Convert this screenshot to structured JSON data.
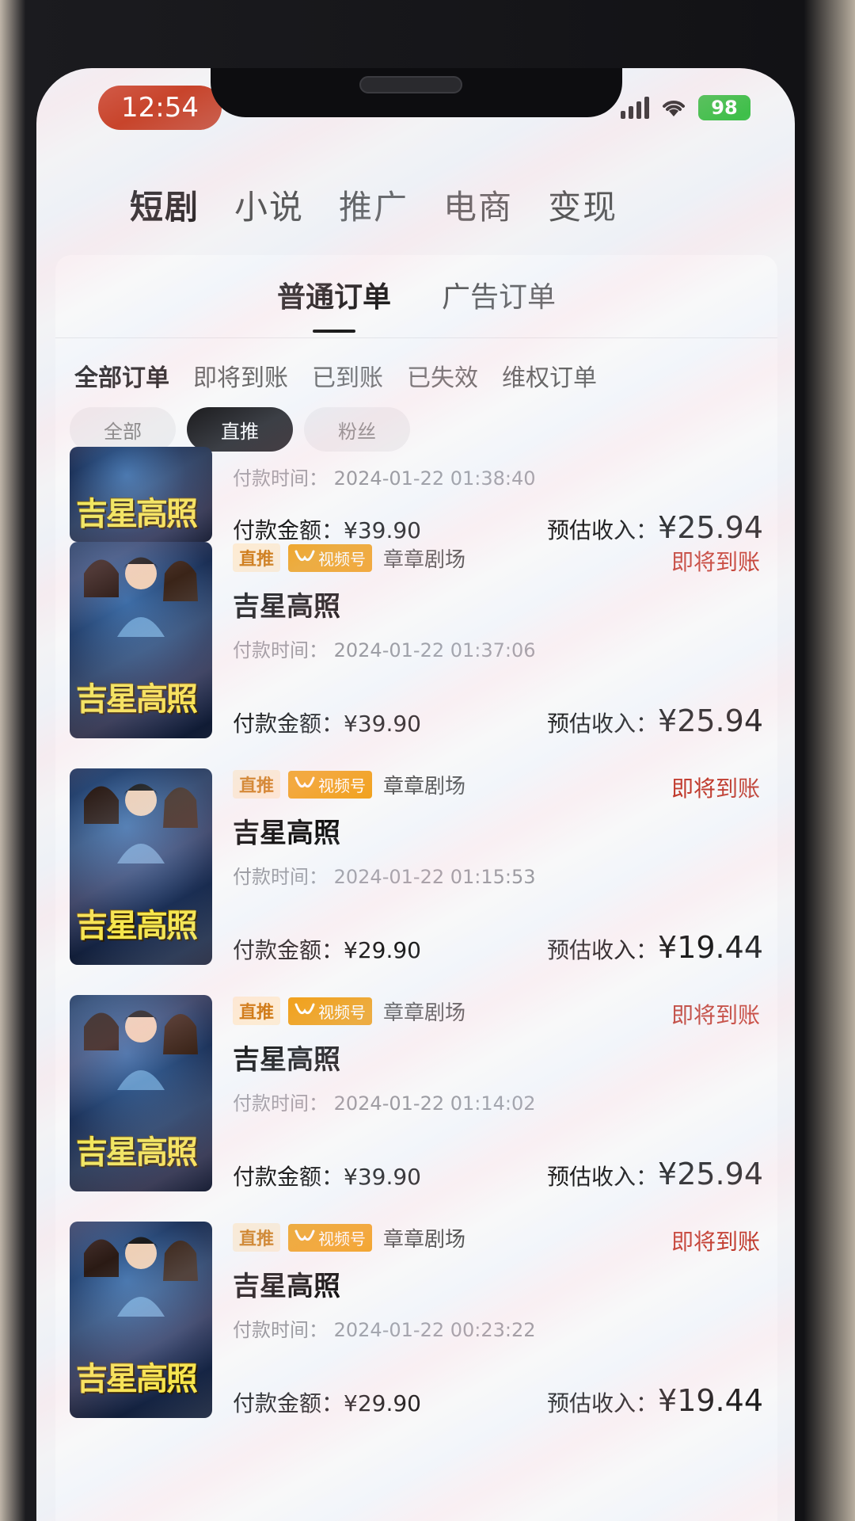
{
  "status_bar": {
    "time": "12:54",
    "battery": "98"
  },
  "top_tabs": [
    {
      "label": "短剧",
      "active": true
    },
    {
      "label": "小说",
      "active": false
    },
    {
      "label": "推广",
      "active": false
    },
    {
      "label": "电商",
      "active": false
    },
    {
      "label": "变现",
      "active": false
    }
  ],
  "sub_tabs": [
    {
      "label": "普通订单",
      "active": true
    },
    {
      "label": "广告订单",
      "active": false
    }
  ],
  "status_filters": [
    {
      "label": "全部订单",
      "active": true
    },
    {
      "label": "即将到账",
      "active": false
    },
    {
      "label": "已到账",
      "active": false
    },
    {
      "label": "已失效",
      "active": false
    },
    {
      "label": "维权订单",
      "active": false
    }
  ],
  "chips": [
    {
      "label": "全部",
      "active": false
    },
    {
      "label": "直推",
      "active": true
    },
    {
      "label": "粉丝",
      "active": false
    }
  ],
  "poster_title": "吉星高照",
  "orders": [
    {
      "partial": true,
      "pay_time": "付款时间：  2024-01-22 01:38:40",
      "pay_amount": "付款金额：¥39.90",
      "estimate_label": "预估收入：",
      "estimate_value": "¥25.94"
    },
    {
      "tag": "直推",
      "platform": "视频号",
      "source": "章章剧场",
      "status": "即将到账",
      "title": "吉星高照",
      "pay_time": "付款时间：  2024-01-22 01:37:06",
      "pay_amount": "付款金额：¥39.90",
      "estimate_label": "预估收入：",
      "estimate_value": "¥25.94"
    },
    {
      "tag": "直推",
      "platform": "视频号",
      "source": "章章剧场",
      "status": "即将到账",
      "title": "吉星高照",
      "pay_time": "付款时间：  2024-01-22 01:15:53",
      "pay_amount": "付款金额：¥29.90",
      "estimate_label": "预估收入：",
      "estimate_value": "¥19.44"
    },
    {
      "tag": "直推",
      "platform": "视频号",
      "source": "章章剧场",
      "status": "即将到账",
      "title": "吉星高照",
      "pay_time": "付款时间：  2024-01-22 01:14:02",
      "pay_amount": "付款金额：¥39.90",
      "estimate_label": "预估收入：",
      "estimate_value": "¥25.94"
    },
    {
      "tag": "直推",
      "platform": "视频号",
      "source": "章章剧场",
      "status": "即将到账",
      "title": "吉星高照",
      "pay_time": "付款时间：  2024-01-22 00:23:22",
      "pay_amount": "付款金额：¥29.90",
      "estimate_label": "预估收入：",
      "estimate_value": "¥19.44"
    }
  ],
  "colors": {
    "accent_status": "#c0392b",
    "tag_bg": "#f1a21f",
    "time_pill": "#c8442b"
  },
  "icons": [
    "signal-icon",
    "wifi-icon",
    "battery-icon",
    "video-channel-icon",
    "poster-image"
  ]
}
